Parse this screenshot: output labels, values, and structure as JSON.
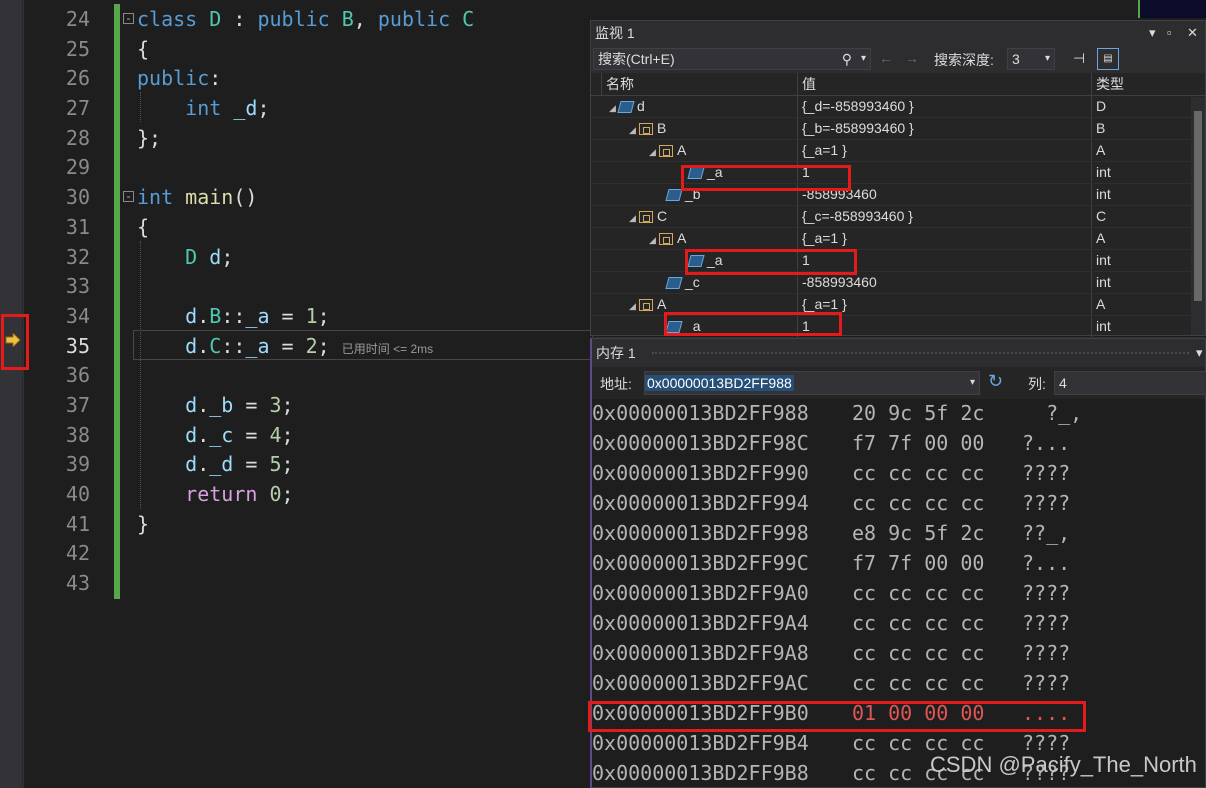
{
  "editor": {
    "line_numbers": [
      "24",
      "25",
      "26",
      "27",
      "28",
      "29",
      "30",
      "31",
      "32",
      "33",
      "34",
      "35",
      "36",
      "37",
      "38",
      "39",
      "40",
      "41",
      "42",
      "43"
    ],
    "current_line": "35",
    "perf_hint": "已用时间 <= 2ms"
  },
  "watch": {
    "title": "监视 1",
    "search_placeholder": "搜索(Ctrl+E)",
    "depth_label": "搜索深度:",
    "depth_value": "3",
    "columns": [
      "名称",
      "值",
      "类型"
    ],
    "rows": [
      {
        "name": "d",
        "value": "{_d=-858993460 }",
        "type": "D"
      },
      {
        "name": "B",
        "value": "{_b=-858993460 }",
        "type": "B"
      },
      {
        "name": "A",
        "value": "{_a=1 }",
        "type": "A"
      },
      {
        "name": "_a",
        "value": "1",
        "type": "int"
      },
      {
        "name": "_b",
        "value": "-858993460",
        "type": "int"
      },
      {
        "name": "C",
        "value": "{_c=-858993460 }",
        "type": "C"
      },
      {
        "name": "A",
        "value": "{_a=1 }",
        "type": "A"
      },
      {
        "name": "_a",
        "value": "1",
        "type": "int"
      },
      {
        "name": "_c",
        "value": "-858993460",
        "type": "int"
      },
      {
        "name": "A",
        "value": "{_a=1 }",
        "type": "A"
      },
      {
        "name": "_a",
        "value": "1",
        "type": "int"
      }
    ]
  },
  "memory": {
    "title": "内存 1",
    "address_label": "地址:",
    "address_value": "0x00000013BD2FF988",
    "columns_label": "列:",
    "columns_value": "4",
    "rows": [
      {
        "addr": "0x00000013BD2FF988",
        "bytes": "20 9c 5f 2c",
        "chars": "  ?_,"
      },
      {
        "addr": "0x00000013BD2FF98C",
        "bytes": "f7 7f 00 00",
        "chars": "?..."
      },
      {
        "addr": "0x00000013BD2FF990",
        "bytes": "cc cc cc cc",
        "chars": "????"
      },
      {
        "addr": "0x00000013BD2FF994",
        "bytes": "cc cc cc cc",
        "chars": "????"
      },
      {
        "addr": "0x00000013BD2FF998",
        "bytes": "e8 9c 5f 2c",
        "chars": "??_,"
      },
      {
        "addr": "0x00000013BD2FF99C",
        "bytes": "f7 7f 00 00",
        "chars": "?..."
      },
      {
        "addr": "0x00000013BD2FF9A0",
        "bytes": "cc cc cc cc",
        "chars": "????"
      },
      {
        "addr": "0x00000013BD2FF9A4",
        "bytes": "cc cc cc cc",
        "chars": "????"
      },
      {
        "addr": "0x00000013BD2FF9A8",
        "bytes": "cc cc cc cc",
        "chars": "????"
      },
      {
        "addr": "0x00000013BD2FF9AC",
        "bytes": "cc cc cc cc",
        "chars": "????"
      },
      {
        "addr": "0x00000013BD2FF9B0",
        "bytes": "01 00 00 00",
        "chars": "...."
      },
      {
        "addr": "0x00000013BD2FF9B4",
        "bytes": "cc cc cc cc",
        "chars": "????"
      },
      {
        "addr": "0x00000013BD2FF9B8",
        "bytes": "cc cc cc cc",
        "chars": "????"
      }
    ]
  },
  "watermark": "CSDN @Pacify_The_North"
}
